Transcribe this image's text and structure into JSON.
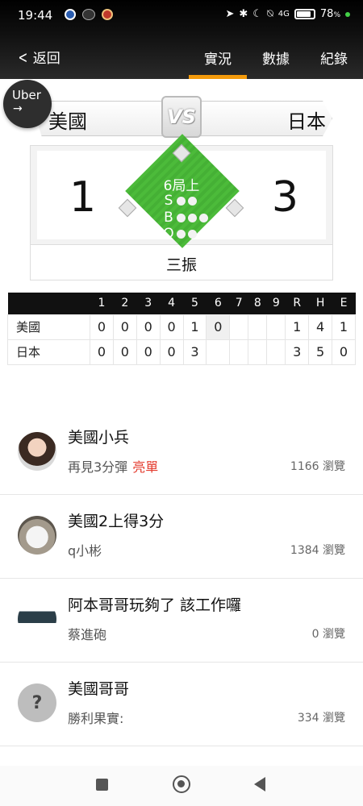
{
  "status_bar": {
    "time": "19:44",
    "network": "4G",
    "battery_percent": "78",
    "battery_unit": "%"
  },
  "nav": {
    "back_label": "返回",
    "tabs": [
      {
        "label": "實況",
        "active": true
      },
      {
        "label": "數據",
        "active": false
      },
      {
        "label": "紀錄",
        "active": false
      }
    ]
  },
  "ad": {
    "brand": "Uber",
    "arrow": "→"
  },
  "game": {
    "home_team": "美國",
    "away_team": "日本",
    "vs": "VS",
    "home_score": "1",
    "away_score": "3",
    "inning": "6局上",
    "count": {
      "strikes": 2,
      "balls": 3,
      "outs": 2,
      "labels": [
        "S",
        "B",
        "O"
      ]
    },
    "last_event": "三振"
  },
  "linescore": {
    "headers": [
      "",
      "1",
      "2",
      "3",
      "4",
      "5",
      "6",
      "7",
      "8",
      "9",
      "R",
      "H",
      "E"
    ],
    "rows": [
      {
        "team": "美國",
        "innings": [
          "0",
          "0",
          "0",
          "0",
          "1",
          "0",
          "",
          "",
          ""
        ],
        "R": "1",
        "H": "4",
        "E": "1"
      },
      {
        "team": "日本",
        "innings": [
          "0",
          "0",
          "0",
          "0",
          "3",
          "",
          "",
          "",
          ""
        ],
        "R": "3",
        "H": "5",
        "E": "0"
      }
    ]
  },
  "feed": [
    {
      "title": "美國小兵",
      "subtitle": "再見3分彈",
      "tag": "亮單",
      "views": "1166 瀏覽",
      "avatar": "person-photo"
    },
    {
      "title": "美國2上得3分",
      "subtitle": "q小彬",
      "tag": "",
      "views": "1384 瀏覽",
      "avatar": "cat-photo"
    },
    {
      "title": "阿本哥哥玩夠了 該工作囉",
      "subtitle": "蔡進砲",
      "tag": "",
      "views": "0 瀏覽",
      "avatar": "cannon-photo"
    },
    {
      "title": "美國哥哥",
      "subtitle": "勝利果實:",
      "tag": "",
      "views": "334 瀏覽",
      "avatar": "question-icon"
    }
  ],
  "colors": {
    "accent": "#f39a0b",
    "field": "#4cbb3a",
    "tag": "#e43c2f"
  }
}
